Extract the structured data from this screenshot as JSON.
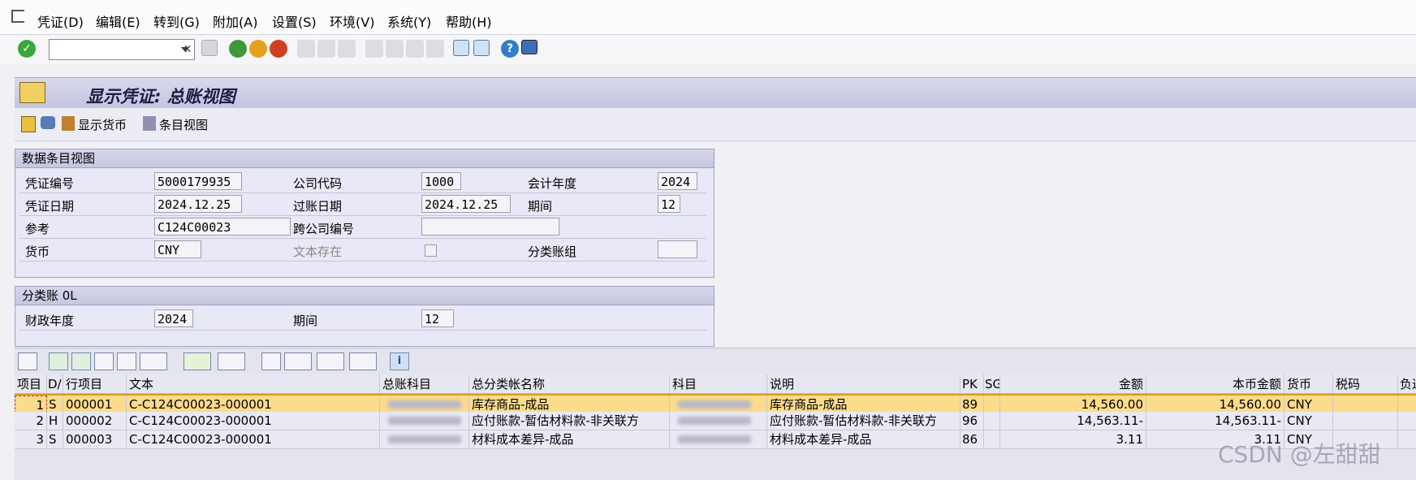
{
  "menu": [
    "凭证(D)",
    "编辑(E)",
    "转到(G)",
    "附加(A)",
    "设置(S)",
    "环境(V)",
    "系统(Y)",
    "帮助(H)"
  ],
  "toolbar": {
    "command_value": "",
    "back_glyph": "«"
  },
  "title": "显示凭证: 总账视图",
  "app_toolbar": {
    "display_currency": "显示货币",
    "entry_view": "条目视图"
  },
  "data_entry_view": {
    "header": "数据条目视图",
    "doc_no_label": "凭证编号",
    "doc_no": "5000179935",
    "company_code_label": "公司代码",
    "company_code": "1000",
    "fiscal_year_label": "会计年度",
    "fiscal_year": "2024",
    "doc_date_label": "凭证日期",
    "doc_date": "2024.12.25",
    "posting_date_label": "过账日期",
    "posting_date": "2024.12.25",
    "period_label": "期间",
    "period": "12",
    "reference_label": "参考",
    "reference": "C124C00023",
    "cross_company_label": "跨公司编号",
    "cross_company": "",
    "currency_label": "货币",
    "currency": "CNY",
    "text_exists_label": "文本存在",
    "ledger_group_label": "分类账组",
    "ledger_group": ""
  },
  "ledger": {
    "header": "分类账 0L",
    "fiscal_year_label": "财政年度",
    "fiscal_year": "2024",
    "period_label": "期间",
    "period": "12"
  },
  "grid": {
    "columns": [
      "项目",
      "D/",
      "行项目",
      "文本",
      "总账科目",
      "总分类帐名称",
      "科目",
      "说明",
      "PK",
      "SG",
      "金额",
      "本币金额",
      "货币",
      "税码",
      "负过账"
    ],
    "rows": [
      [
        "1",
        "S",
        "000001",
        "C-C124C00023-000001",
        "",
        "库存商品-成品",
        "",
        "库存商品-成品",
        "89",
        "",
        "14,560.00",
        "14,560.00",
        "CNY",
        "",
        ""
      ],
      [
        "2",
        "H",
        "000002",
        "C-C124C00023-000001",
        "",
        "应付账款-暂估材料款-非关联方",
        "",
        "应付账款-暂估材料款-非关联方",
        "96",
        "",
        "14,563.11-",
        "14,563.11-",
        "CNY",
        "",
        ""
      ],
      [
        "3",
        "S",
        "000003",
        "C-C124C00023-000001",
        "",
        "材料成本差异-成品",
        "",
        "材料成本差异-成品",
        "86",
        "",
        "3.11",
        "3.11",
        "CNY",
        "",
        ""
      ]
    ]
  },
  "watermark": "CSDN @左甜甜"
}
